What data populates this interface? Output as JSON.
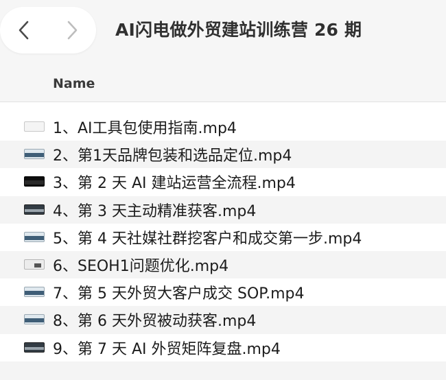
{
  "window": {
    "title": "AI闪电做外贸建站训练营 26 期"
  },
  "columns": {
    "name": "Name"
  },
  "files": [
    {
      "name": "1、AI工具包使用指南.mp4",
      "thumb": "light"
    },
    {
      "name": "2、第1天品牌包装和选品定位.mp4",
      "thumb": "blue"
    },
    {
      "name": "3、第 2 天 AI 建站运营全流程.mp4",
      "thumb": "dark"
    },
    {
      "name": "4、第 3 天主动精准获客.mp4",
      "thumb": "gray"
    },
    {
      "name": "5、第 4 天社媒社群挖客户和成交第一步.mp4",
      "thumb": "blue"
    },
    {
      "name": "6、SEOH1问题优化.mp4",
      "thumb": "mixed"
    },
    {
      "name": "7、第 5 天外贸大客户成交 SOP.mp4",
      "thumb": "blue"
    },
    {
      "name": "8、第 6 天外贸被动获客.mp4",
      "thumb": "blue"
    },
    {
      "name": "9、第 7 天 AI 外贸矩阵复盘.mp4",
      "thumb": "gray"
    }
  ],
  "icons": {
    "back": "chevron-left-icon",
    "forward": "chevron-right-icon"
  }
}
